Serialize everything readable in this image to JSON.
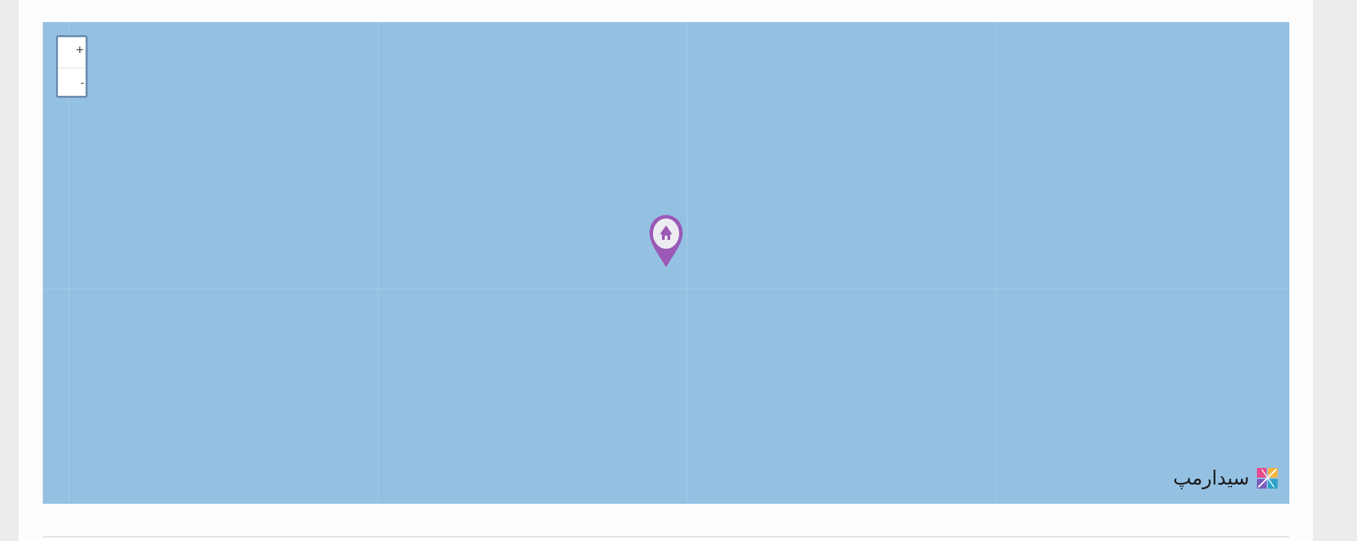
{
  "map": {
    "zoom_in_label": "+",
    "zoom_out_label": "-",
    "brand_name": "سیدارمپ",
    "marker_icon": "home-icon",
    "colors": {
      "water": "#94c1e2",
      "marker": "#9b59b6",
      "zoom_border": "#6d8fb1"
    }
  }
}
